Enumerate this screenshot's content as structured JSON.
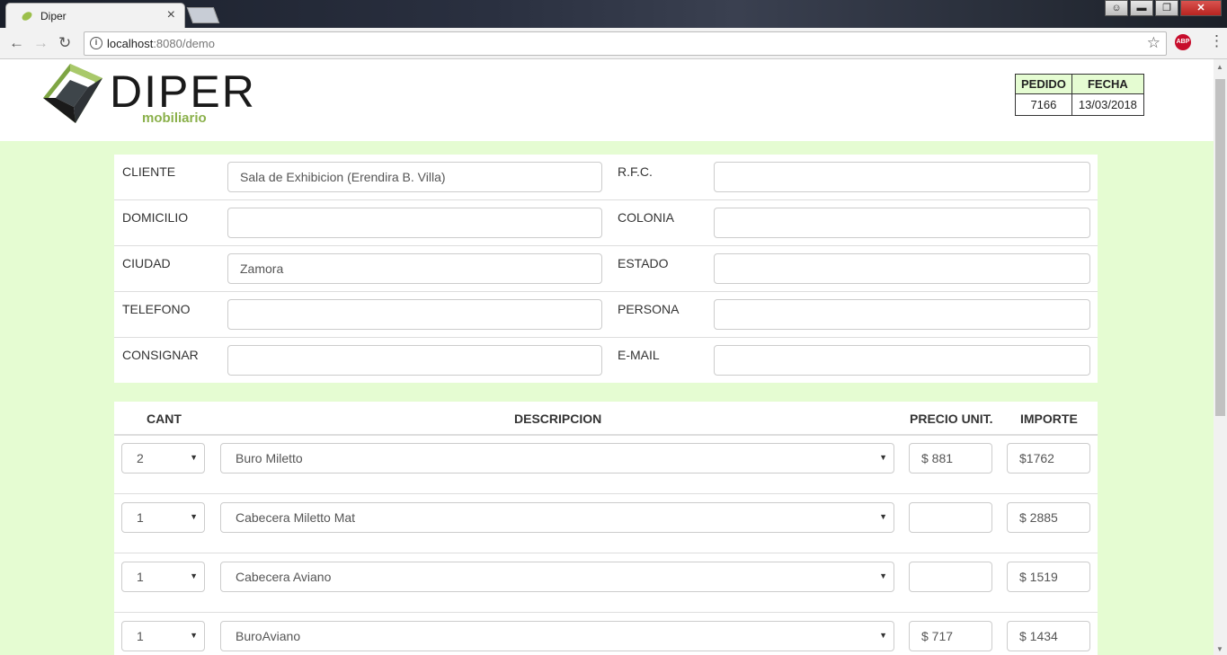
{
  "browser": {
    "tab_title": "Diper",
    "tab_close": "×",
    "url_host": "localhost",
    "url_rest": ":8080/demo",
    "abp_label": "ABP",
    "win_minimize": "▬",
    "win_restore": "❐",
    "win_close": "✕"
  },
  "logo": {
    "title": "DIPER",
    "subtitle": "mobiliario"
  },
  "order": {
    "pedido_label": "PEDIDO",
    "fecha_label": "FECHA",
    "pedido": "7166",
    "fecha": "13/03/2018"
  },
  "client": {
    "cliente_label": "CLIENTE",
    "cliente": "Sala de Exhibicion (Erendira B. Villa)",
    "rfc_label": "R.F.C.",
    "rfc": "",
    "domicilio_label": "DOMICILIO",
    "domicilio": "",
    "colonia_label": "COLONIA",
    "colonia": "",
    "ciudad_label": "CIUDAD",
    "ciudad": "Zamora",
    "estado_label": "ESTADO",
    "estado": "",
    "telefono_label": "TELEFONO",
    "telefono": "",
    "persona_label": "PERSONA",
    "persona": "",
    "consignar_label": "CONSIGNAR",
    "consignar": "",
    "email_label": "E-MAIL",
    "email": ""
  },
  "items_header": {
    "cant": "CANT",
    "descripcion": "DESCRIPCION",
    "precio": "PRECIO UNIT.",
    "importe": "IMPORTE"
  },
  "items": [
    {
      "cant": "2",
      "descripcion": "Buro Miletto",
      "precio": "$ 881",
      "importe": "$1762"
    },
    {
      "cant": "1",
      "descripcion": "Cabecera Miletto Mat",
      "precio": "",
      "importe": "$ 2885"
    },
    {
      "cant": "1",
      "descripcion": "Cabecera Aviano",
      "precio": "",
      "importe": "$ 1519"
    },
    {
      "cant": "1",
      "descripcion": "BuroAviano",
      "precio": "$ 717",
      "importe": "$ 1434"
    }
  ]
}
